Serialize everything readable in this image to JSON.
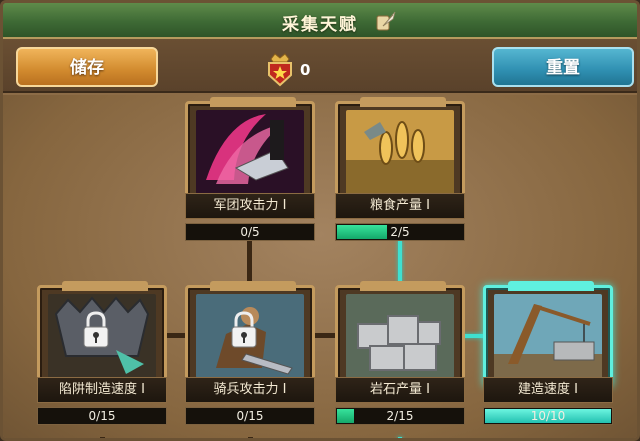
{
  "header": {
    "title": "采集天赋",
    "title_icon": "scroll-feather-icon"
  },
  "toolbar": {
    "store_label": "储存",
    "reset_label": "重置",
    "points_icon": "crown-star-badge-icon",
    "points_value": "0"
  },
  "colors": {
    "store_button": "#d18a2e",
    "reset_button": "#2f8fb1",
    "progress_fill": "#14a86a",
    "active_glow": "#44e0d0"
  },
  "talents": [
    {
      "name": "军团攻击力 I",
      "progress_text": "0/5",
      "current": 0,
      "max": 5,
      "locked": false,
      "art": "blade-icon"
    },
    {
      "name": "粮食产量 I",
      "progress_text": "2/5",
      "current": 2,
      "max": 5,
      "locked": false,
      "art": "wheat-icon"
    },
    {
      "name": "陷阱制造速度 I",
      "progress_text": "0/15",
      "current": 0,
      "max": 15,
      "locked": true,
      "art": "trap-icon"
    },
    {
      "name": "骑兵攻击力 I",
      "progress_text": "0/15",
      "current": 0,
      "max": 15,
      "locked": true,
      "art": "cavalry-icon"
    },
    {
      "name": "岩石产量 I",
      "progress_text": "2/15",
      "current": 2,
      "max": 15,
      "locked": false,
      "art": "stone-icon"
    },
    {
      "name": "建造速度 I",
      "progress_text": "10/10",
      "current": 10,
      "max": 10,
      "locked": false,
      "art": "crane-icon"
    }
  ]
}
